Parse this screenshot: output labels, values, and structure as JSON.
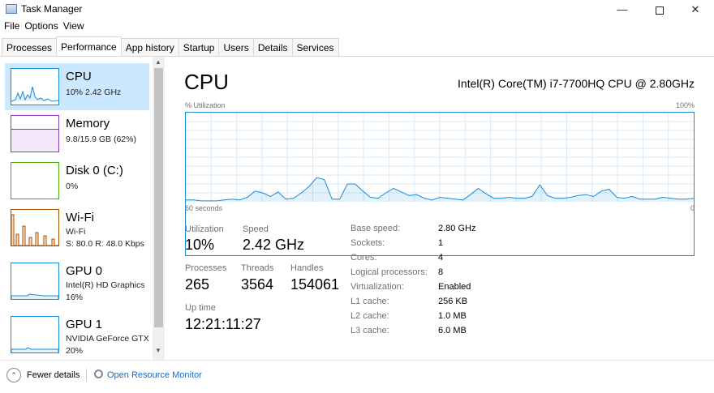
{
  "window": {
    "title": "Task Manager",
    "minimize_glyph": "—",
    "close_glyph": "✕"
  },
  "menu": [
    "File",
    "Options",
    "View"
  ],
  "tabs": [
    "Processes",
    "Performance",
    "App history",
    "Startup",
    "Users",
    "Details",
    "Services"
  ],
  "active_tab": "Performance",
  "sidebar": {
    "items": [
      {
        "name": "CPU",
        "sub1": "10%  2.42 GHz",
        "sub2": "",
        "sub3": "",
        "color": "#1a8bd8"
      },
      {
        "name": "Memory",
        "sub1": "9.8/15.9 GB (62%)",
        "sub2": "",
        "sub3": "",
        "color": "#8a3ab9"
      },
      {
        "name": "Disk 0 (C:)",
        "sub1": "0%",
        "sub2": "",
        "sub3": "",
        "color": "#4da60c"
      },
      {
        "name": "Wi-Fi",
        "sub1": "Wi-Fi",
        "sub2": "S: 80.0  R: 48.0 Kbps",
        "sub3": "",
        "color": "#a74f01"
      },
      {
        "name": "GPU 0",
        "sub1": "Intel(R) HD Graphics",
        "sub2": "16%",
        "sub3": "",
        "color": "#1a8bd8"
      },
      {
        "name": "GPU 1",
        "sub1": "NVIDIA GeForce GTX",
        "sub2": "20%",
        "sub3": "",
        "color": "#1a8bd8"
      }
    ],
    "scroll_up": "▲",
    "scroll_down": "▼"
  },
  "main": {
    "title": "CPU",
    "model": "Intel(R) Core(TM) i7-7700HQ CPU @ 2.80GHz",
    "util_label": "% Utilization",
    "max_label": "100%",
    "time_label": "60 seconds",
    "zero_label": "0",
    "graph_color": "#1a8bd8",
    "graph_values": [
      2,
      2,
      1,
      1,
      1,
      2,
      3,
      2,
      5,
      12,
      10,
      6,
      11,
      3,
      4,
      10,
      17,
      27,
      25,
      3,
      3,
      20,
      20,
      12,
      5,
      4,
      10,
      15,
      11,
      7,
      8,
      4,
      2,
      5,
      4,
      3,
      2,
      8,
      15,
      9,
      4,
      4,
      5,
      4,
      4,
      6,
      19,
      7,
      4,
      4,
      5,
      7,
      8,
      6,
      12,
      14,
      5,
      4,
      6,
      3,
      3,
      3,
      5,
      4,
      3,
      3,
      4
    ],
    "stats": {
      "utilization_label": "Utilization",
      "utilization_value": "10%",
      "speed_label": "Speed",
      "speed_value": "2.42 GHz",
      "processes_label": "Processes",
      "processes_value": "265",
      "threads_label": "Threads",
      "threads_value": "3564",
      "handles_label": "Handles",
      "handles_value": "154061",
      "uptime_label": "Up time",
      "uptime_value": "12:21:11:27"
    },
    "specs": [
      {
        "label": "Base speed:",
        "value": "2.80 GHz"
      },
      {
        "label": "Sockets:",
        "value": "1"
      },
      {
        "label": "Cores:",
        "value": "4"
      },
      {
        "label": "Logical processors:",
        "value": "8"
      },
      {
        "label": "Virtualization:",
        "value": "Enabled"
      },
      {
        "label": "L1 cache:",
        "value": "256 KB"
      },
      {
        "label": "L2 cache:",
        "value": "1.0 MB"
      },
      {
        "label": "L3 cache:",
        "value": "6.0 MB"
      }
    ]
  },
  "footer": {
    "fewer_details": "Fewer details",
    "fewer_icon": "⌃",
    "resource_monitor": "Open Resource Monitor"
  }
}
